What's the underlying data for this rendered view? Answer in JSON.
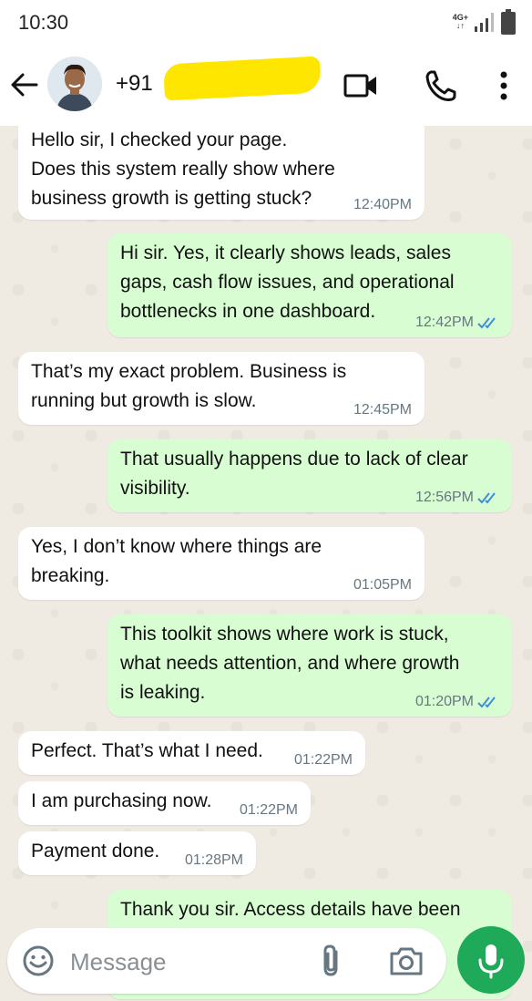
{
  "status_bar": {
    "time": "10:30",
    "network": "4G+"
  },
  "header": {
    "contact_name": "+91 "
  },
  "messages": [
    {
      "dir": "in",
      "text": "Hello sir, I checked your page.\nDoes this system really show where\nbusiness growth is getting stuck?",
      "time": "12:40PM"
    },
    {
      "dir": "out",
      "text": "Hi sir. Yes, it clearly shows leads, sales\ngaps, cash flow issues, and operational\nbottlenecks in one dashboard.",
      "time": "12:42PM"
    },
    {
      "dir": "in",
      "text": "That’s my exact problem. Business is\nrunning but growth is slow.",
      "time": "12:45PM"
    },
    {
      "dir": "out",
      "text": "That usually happens due to lack of clear\nvisibility.",
      "time": "12:56PM"
    },
    {
      "dir": "in",
      "text": "Yes, I don’t know where things are\nbreaking.",
      "time": "01:05PM"
    },
    {
      "dir": "out",
      "text": "This toolkit shows where work is stuck,\nwhat needs attention, and where growth\nis leaking.",
      "time": "01:20PM"
    },
    {
      "dir": "in",
      "text": "Perfect. That’s what I need.",
      "time": "01:22PM"
    },
    {
      "dir": "in",
      "text": "I am purchasing now.",
      "time": "01:22PM"
    },
    {
      "dir": "in",
      "text": "Payment done.",
      "time": "01:28PM"
    },
    {
      "dir": "out",
      "text": "Thank you sir. Access details have been",
      "time": ""
    }
  ],
  "composer": {
    "placeholder": "Message"
  },
  "colors": {
    "incoming": "#ffffff",
    "outgoing": "#d9fdd3",
    "accent": "#1faa59",
    "read_ticks": "#3a8ee6",
    "redaction": "#ffe600"
  }
}
